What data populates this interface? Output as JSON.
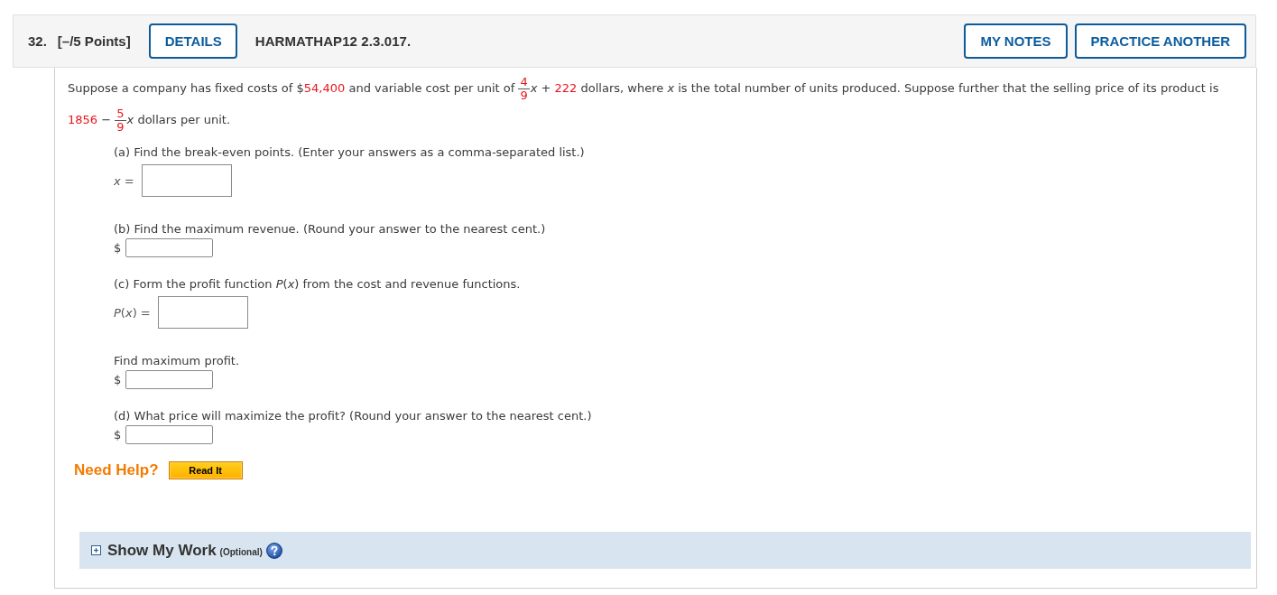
{
  "header": {
    "number": "32.",
    "points": "[–/5 Points]",
    "details_button": "DETAILS",
    "problem_code": "HARMATHAP12 2.3.017.",
    "actions": [
      "MY NOTES",
      "PRACTICE ANOTHER"
    ]
  },
  "statement": [
    {
      "kind": "text",
      "text": "Suppose a company has fixed costs of $"
    },
    {
      "kind": "value",
      "text": "54,400"
    },
    {
      "kind": "text",
      "text": " and variable cost per unit of "
    },
    {
      "kind": "fraction",
      "numerator": "4",
      "denominator": "9"
    },
    {
      "kind": "text",
      "text": "*x* + "
    },
    {
      "kind": "value",
      "text": "222"
    },
    {
      "kind": "text",
      "text": " dollars, where *x* is the total number of units produced. Suppose further that the selling price of its product is "
    },
    {
      "kind": "value",
      "text": "1856"
    },
    {
      "kind": "text",
      "text": " − "
    },
    {
      "kind": "fraction",
      "numerator": "5",
      "denominator": "9"
    },
    {
      "kind": "text",
      "text": "*x* dollars per unit."
    }
  ],
  "parts": [
    {
      "prompt": "(a) Find the break-even points. (Enter your answers as a comma-separated list.)",
      "answer": {
        "kind": "equation",
        "label": "*x* ="
      }
    },
    {
      "prompt": "(b) Find the maximum revenue. (Round your answer to the nearest cent.)",
      "answer": {
        "kind": "currency",
        "label": "$"
      }
    },
    {
      "prompt": "(c) Form the profit function *P*(*x*) from the cost and revenue functions.",
      "answer": {
        "kind": "equation",
        "label": "*P*(*x*) ="
      }
    },
    {
      "prompt": "Find maximum profit.",
      "answer": {
        "kind": "currency",
        "label": "$"
      }
    },
    {
      "prompt": "(d) What price will maximize the profit? (Round your answer to the nearest cent.)",
      "answer": {
        "kind": "currency",
        "label": "$"
      }
    }
  ],
  "help": {
    "label": "Need Help?",
    "buttons": [
      "Read It"
    ]
  },
  "show_my_work": {
    "title": "Show My Work",
    "note": "(Optional)",
    "expanded": false
  }
}
